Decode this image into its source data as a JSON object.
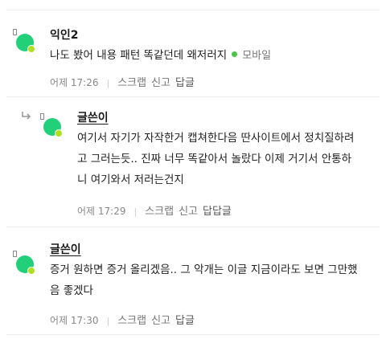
{
  "comments": [
    {
      "nickname": "익인2",
      "text": "나도 봤어 내용 패턴 똑같던데 왜저러지",
      "mobile_label": "모바일",
      "time": "어제 17:26",
      "actions": [
        "스크랩",
        "신고",
        "답글"
      ]
    },
    {
      "nickname": "글쓴이",
      "lines": [
        "여기서 자기가 자작한거 캡쳐한다음 딴사이트에서 정치질하려",
        "고 그러는듯.. 진짜 너무 똑같아서 놀랐다 이제 거기서 안통하",
        "니 여기와서 저러는건지"
      ],
      "time": "어제 17:29",
      "actions": [
        "스크랩",
        "신고",
        "답답글"
      ]
    },
    {
      "nickname": "글쓴이",
      "lines": [
        "증거 원하면 증거 올리겠음.. 그 악개는 이글 지금이라도 보면 그만했",
        "음 좋겠다"
      ],
      "time": "어제 17:30",
      "actions": [
        "스크랩",
        "신고",
        "답글"
      ]
    }
  ],
  "colors": {
    "avatar": "#22d07a",
    "avatar_dot": "#aee01e",
    "mobile_dot": "#4cc44c"
  }
}
